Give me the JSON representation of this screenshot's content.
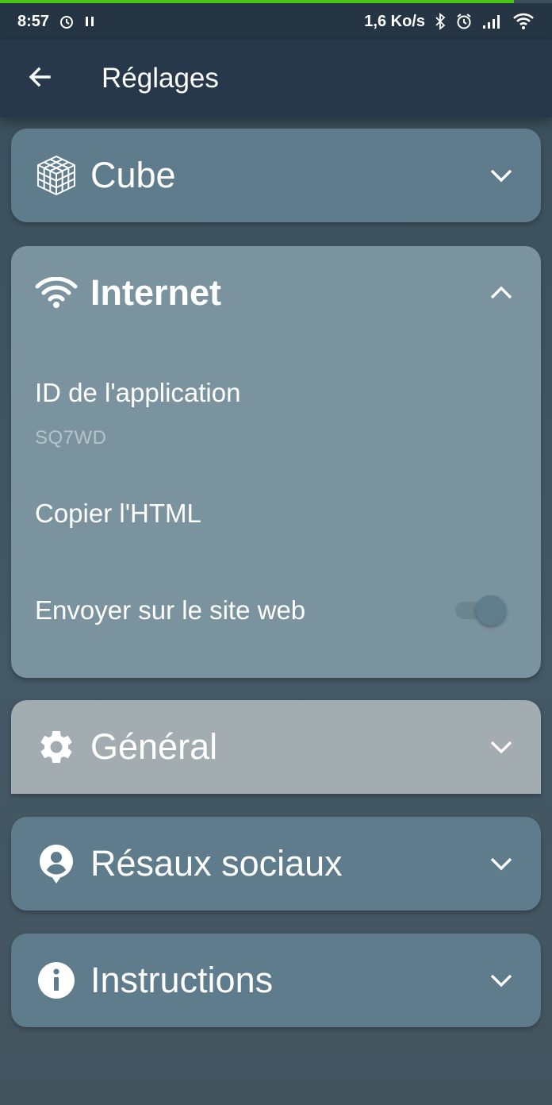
{
  "status_bar": {
    "time": "8:57",
    "network_speed": "1,6 Ko/s"
  },
  "app_bar": {
    "title": "Réglages"
  },
  "sections": {
    "cube": {
      "title": "Cube",
      "icon": "cube-grid-icon",
      "expanded": false
    },
    "internet": {
      "title": "Internet",
      "icon": "wifi-icon",
      "expanded": true,
      "app_id_label": "ID de l'application",
      "app_id_value": "SQ7WD",
      "copy_html_label": "Copier l'HTML",
      "send_website_label": "Envoyer sur le site web",
      "send_website_enabled": false
    },
    "general": {
      "title": "Général",
      "icon": "gear-icon",
      "expanded": false
    },
    "social": {
      "title": "Résaux sociaux",
      "icon": "account-pin-icon",
      "expanded": false
    },
    "instructions": {
      "title": "Instructions",
      "icon": "info-icon",
      "expanded": false
    }
  },
  "colors": {
    "progress_accent": "#4cc417",
    "card": "#5e7c8c",
    "card_expanded": "#7a939e",
    "card_pressed": "#a3acb1",
    "app_bar": "#26384a"
  }
}
